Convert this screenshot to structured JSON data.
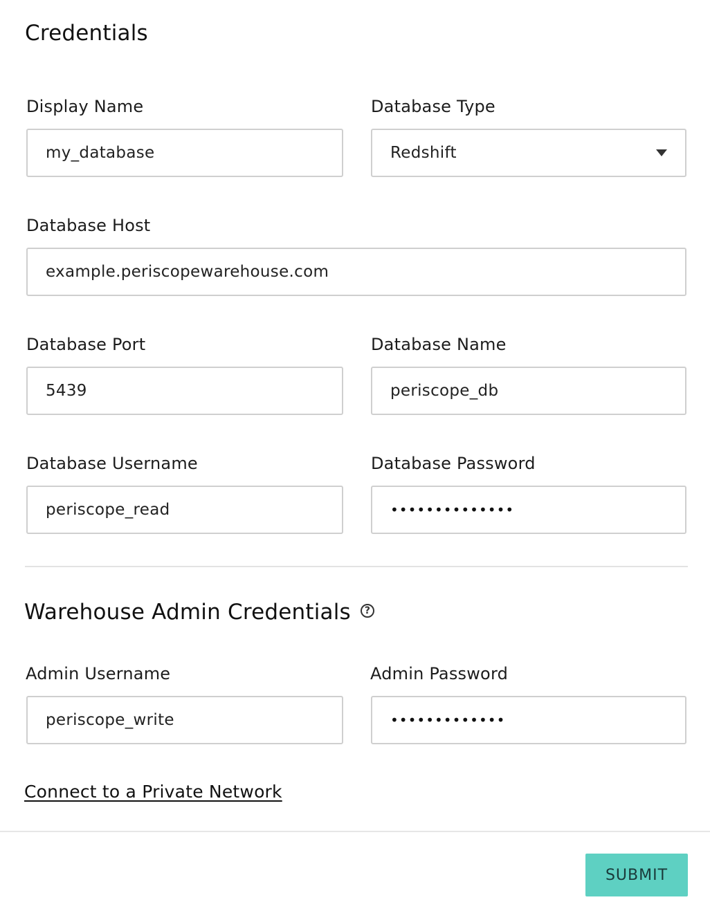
{
  "credentials": {
    "title": "Credentials",
    "display_name": {
      "label": "Display Name",
      "value": "my_database"
    },
    "database_type": {
      "label": "Database Type",
      "value": "Redshift"
    },
    "database_host": {
      "label": "Database Host",
      "value": "example.periscopewarehouse.com"
    },
    "database_port": {
      "label": "Database Port",
      "value": "5439"
    },
    "database_name": {
      "label": "Database Name",
      "value": "periscope_db"
    },
    "database_username": {
      "label": "Database Username",
      "value": "periscope_read"
    },
    "database_password": {
      "label": "Database Password",
      "value": "••••••••••••••"
    }
  },
  "admin": {
    "title": "Warehouse Admin Credentials",
    "help_icon": "question-circle-icon",
    "admin_username": {
      "label": "Admin Username",
      "value": "periscope_write"
    },
    "admin_password": {
      "label": "Admin Password",
      "value": "•••••••••••••"
    }
  },
  "private_network_link": "Connect to a Private Network",
  "submit_label": "SUBMIT",
  "colors": {
    "submit_bg": "#5ed0c2",
    "input_border": "#cfcfcf",
    "divider": "#e3e3e3"
  }
}
